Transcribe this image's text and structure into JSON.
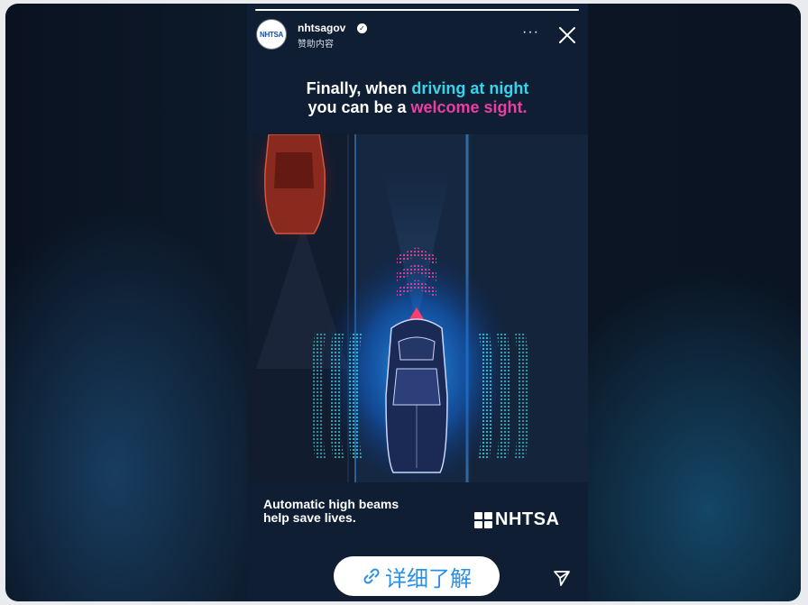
{
  "story": {
    "progress_fraction": 1.0,
    "account": {
      "username": "nhtsagov",
      "verified": true,
      "sponsored_label": "赞助内容",
      "avatar_text": "NHTSA"
    },
    "actions": {
      "more_label": "···",
      "close_icon": "close-icon"
    },
    "headline": {
      "line1_prefix": "Finally, when ",
      "line1_highlight": "driving at night",
      "line2_prefix": "you can be a ",
      "line2_highlight": "welcome sight."
    },
    "footer": {
      "tagline_line1": "Automatic high beams",
      "tagline_line2": "help save lives.",
      "brand": "NHTSA"
    },
    "cta": {
      "label": "详细了解",
      "icon": "link-icon"
    },
    "share_icon": "send-icon"
  },
  "colors": {
    "accent_cyan": "#37d4ec",
    "accent_pink": "#ea3fa2",
    "cta_text": "#2c8fe6",
    "story_bg": "#0f1e33"
  }
}
